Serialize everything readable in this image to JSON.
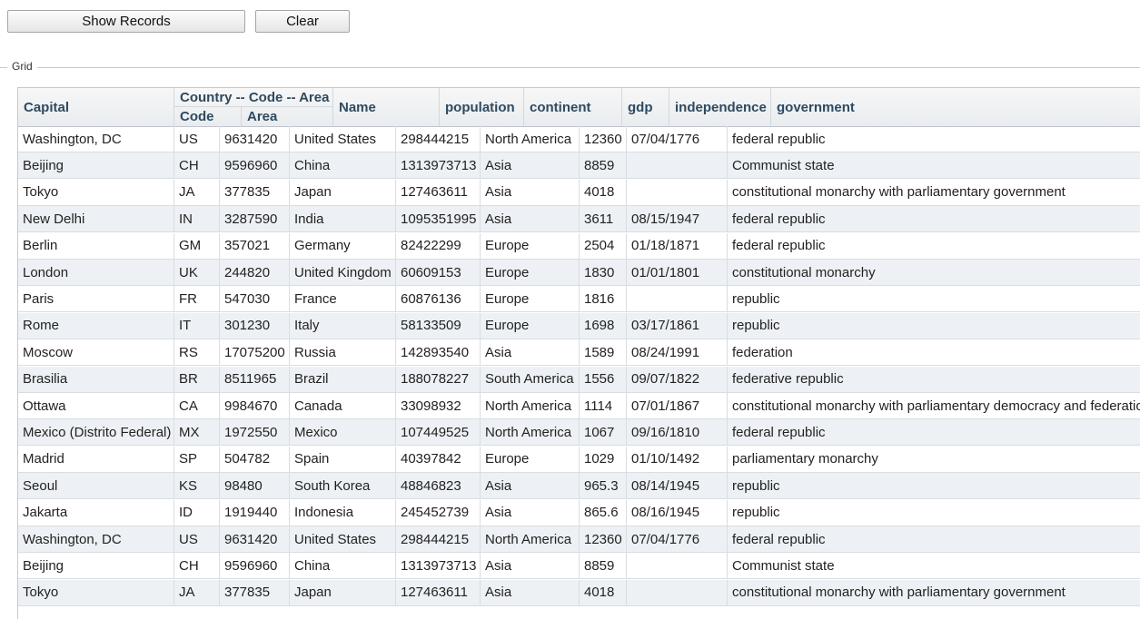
{
  "toolbar": {
    "show_records_label": "Show Records",
    "clear_label": "Clear"
  },
  "fieldset": {
    "legend": "Grid"
  },
  "grid": {
    "group_header": "Country -- Code -- Area",
    "columns": [
      "Capital",
      "Code",
      "Area",
      "Name",
      "population",
      "continent",
      "gdp",
      "independence",
      "government"
    ],
    "rows": [
      [
        "Washington, DC",
        "US",
        "9631420",
        "United States",
        "298444215",
        "North America",
        "12360",
        "07/04/1776",
        "federal republic"
      ],
      [
        "Beijing",
        "CH",
        "9596960",
        "China",
        "1313973713",
        "Asia",
        "8859",
        "",
        "Communist state"
      ],
      [
        "Tokyo",
        "JA",
        "377835",
        "Japan",
        "127463611",
        "Asia",
        "4018",
        "",
        "constitutional monarchy with parliamentary government"
      ],
      [
        "New Delhi",
        "IN",
        "3287590",
        "India",
        "1095351995",
        "Asia",
        "3611",
        "08/15/1947",
        "federal republic"
      ],
      [
        "Berlin",
        "GM",
        "357021",
        "Germany",
        "82422299",
        "Europe",
        "2504",
        "01/18/1871",
        "federal republic"
      ],
      [
        "London",
        "UK",
        "244820",
        "United Kingdom",
        "60609153",
        "Europe",
        "1830",
        "01/01/1801",
        "constitutional monarchy"
      ],
      [
        "Paris",
        "FR",
        "547030",
        "France",
        "60876136",
        "Europe",
        "1816",
        "",
        "republic"
      ],
      [
        "Rome",
        "IT",
        "301230",
        "Italy",
        "58133509",
        "Europe",
        "1698",
        "03/17/1861",
        "republic"
      ],
      [
        "Moscow",
        "RS",
        "17075200",
        "Russia",
        "142893540",
        "Asia",
        "1589",
        "08/24/1991",
        "federation"
      ],
      [
        "Brasilia",
        "BR",
        "8511965",
        "Brazil",
        "188078227",
        "South America",
        "1556",
        "09/07/1822",
        "federative republic"
      ],
      [
        "Ottawa",
        "CA",
        "9984670",
        "Canada",
        "33098932",
        "North America",
        "1114",
        "07/01/1867",
        "constitutional monarchy with parliamentary democracy and federation"
      ],
      [
        "Mexico (Distrito Federal)",
        "MX",
        "1972550",
        "Mexico",
        "107449525",
        "North America",
        "1067",
        "09/16/1810",
        "federal republic"
      ],
      [
        "Madrid",
        "SP",
        "504782",
        "Spain",
        "40397842",
        "Europe",
        "1029",
        "01/10/1492",
        "parliamentary monarchy"
      ],
      [
        "Seoul",
        "KS",
        "98480",
        "South Korea",
        "48846823",
        "Asia",
        "965.3",
        "08/14/1945",
        "republic"
      ],
      [
        "Jakarta",
        "ID",
        "1919440",
        "Indonesia",
        "245452739",
        "Asia",
        "865.6",
        "08/16/1945",
        "republic"
      ],
      [
        "Washington, DC",
        "US",
        "9631420",
        "United States",
        "298444215",
        "North America",
        "12360",
        "07/04/1776",
        "federal republic"
      ],
      [
        "Beijing",
        "CH",
        "9596960",
        "China",
        "1313973713",
        "Asia",
        "8859",
        "",
        "Communist state"
      ],
      [
        "Tokyo",
        "JA",
        "377835",
        "Japan",
        "127463611",
        "Asia",
        "4018",
        "",
        "constitutional monarchy with parliamentary government"
      ]
    ]
  }
}
